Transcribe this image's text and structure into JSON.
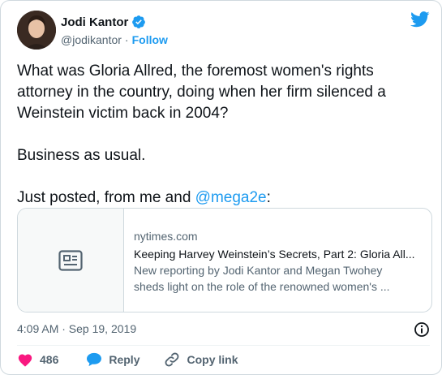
{
  "author": {
    "name": "Jodi Kantor",
    "handle": "@jodikantor",
    "separator": "·",
    "follow_label": "Follow",
    "verified": true
  },
  "tweet": {
    "line1": "What was Gloria Allred, the foremost women's rights attorney in the country, doing when her firm silenced a Weinstein victim back in 2004?",
    "line2": "Business as usual.",
    "line3_prefix": "Just posted, from me and ",
    "mention": "@mega2e",
    "line3_suffix": ":"
  },
  "card": {
    "domain": "nytimes.com",
    "title": "Keeping Harvey Weinstein’s Secrets, Part 2: Gloria All...",
    "desc_line1": "New reporting by Jodi Kantor and Megan Twohey",
    "desc_line2": "sheds light on the role of the renowned women's ..."
  },
  "meta": {
    "timestamp": "4:09 AM · Sep 19, 2019"
  },
  "actions": {
    "like_count": "486",
    "reply_label": "Reply",
    "copy_label": "Copy link"
  },
  "colors": {
    "accent": "#1d9bf0",
    "like": "#f91880",
    "text": "#0f1419",
    "secondary": "#536471"
  },
  "icons": [
    "verified-badge-icon",
    "twitter-bird-icon",
    "article-icon",
    "info-icon",
    "heart-icon",
    "reply-bubble-icon",
    "link-icon"
  ]
}
